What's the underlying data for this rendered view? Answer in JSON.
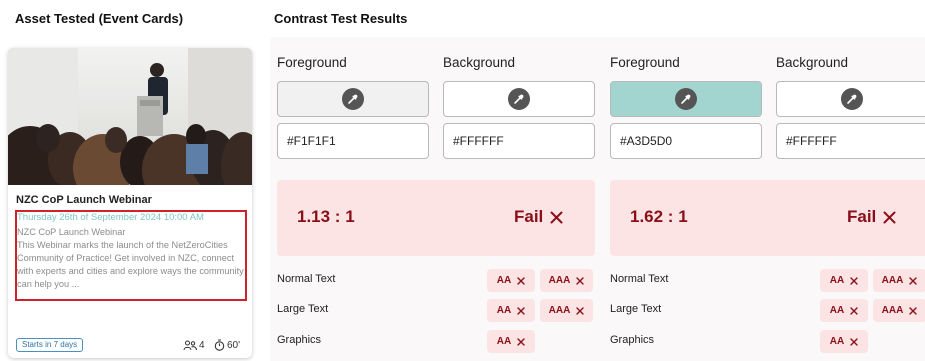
{
  "headings": {
    "asset": "Asset Tested (Event Cards)",
    "results": "Contrast Test Results"
  },
  "card": {
    "title": "NZC CoP Launch Webinar",
    "date": "Thursday 26th of September 2024 10:00 AM",
    "description": [
      "NZC CoP Launch Webinar",
      "This Webinar marks the launch of the NetZeroCities",
      "Community of Practice! Get involved in NZC, connect",
      "with experts and cities and explore ways the community",
      "can help you ..."
    ],
    "badge": "Starts in 7 days",
    "attendees": "4",
    "duration": "60'",
    "date_color": "#A3D5D0",
    "highlight_color": "#D0222A"
  },
  "icons": {
    "picker": "eyedropper-icon",
    "fail": "x-mark-icon",
    "people": "people-icon",
    "timer": "stopwatch-icon"
  },
  "tests": [
    {
      "foreground_label": "Foreground",
      "background_label": "Background",
      "foreground_hex": "#F1F1F1",
      "background_hex": "#FFFFFF",
      "foreground_color": "#F1F1F1",
      "background_color": "#FFFFFF",
      "ratio": "1.13 : 1",
      "verdict": "Fail",
      "rows": [
        {
          "label": "Normal Text",
          "aa": "AA",
          "aaa": "AAA"
        },
        {
          "label": "Large Text",
          "aa": "AA",
          "aaa": "AAA"
        },
        {
          "label": "Graphics",
          "aa": "AA"
        }
      ]
    },
    {
      "foreground_label": "Foreground",
      "background_label": "Background",
      "foreground_hex": "#A3D5D0",
      "background_hex": "#FFFFFF",
      "foreground_color": "#A3D5D0",
      "background_color": "#FFFFFF",
      "ratio": "1.62 : 1",
      "verdict": "Fail",
      "rows": [
        {
          "label": "Normal Text",
          "aa": "AA",
          "aaa": "AAA"
        },
        {
          "label": "Large Text",
          "aa": "AA",
          "aaa": "AAA"
        },
        {
          "label": "Graphics",
          "aa": "AA"
        }
      ]
    }
  ],
  "colors": {
    "fail_bg": "#FCE3E4",
    "fail_text": "#8A0F19",
    "badge_blue": "#2F72A8"
  }
}
